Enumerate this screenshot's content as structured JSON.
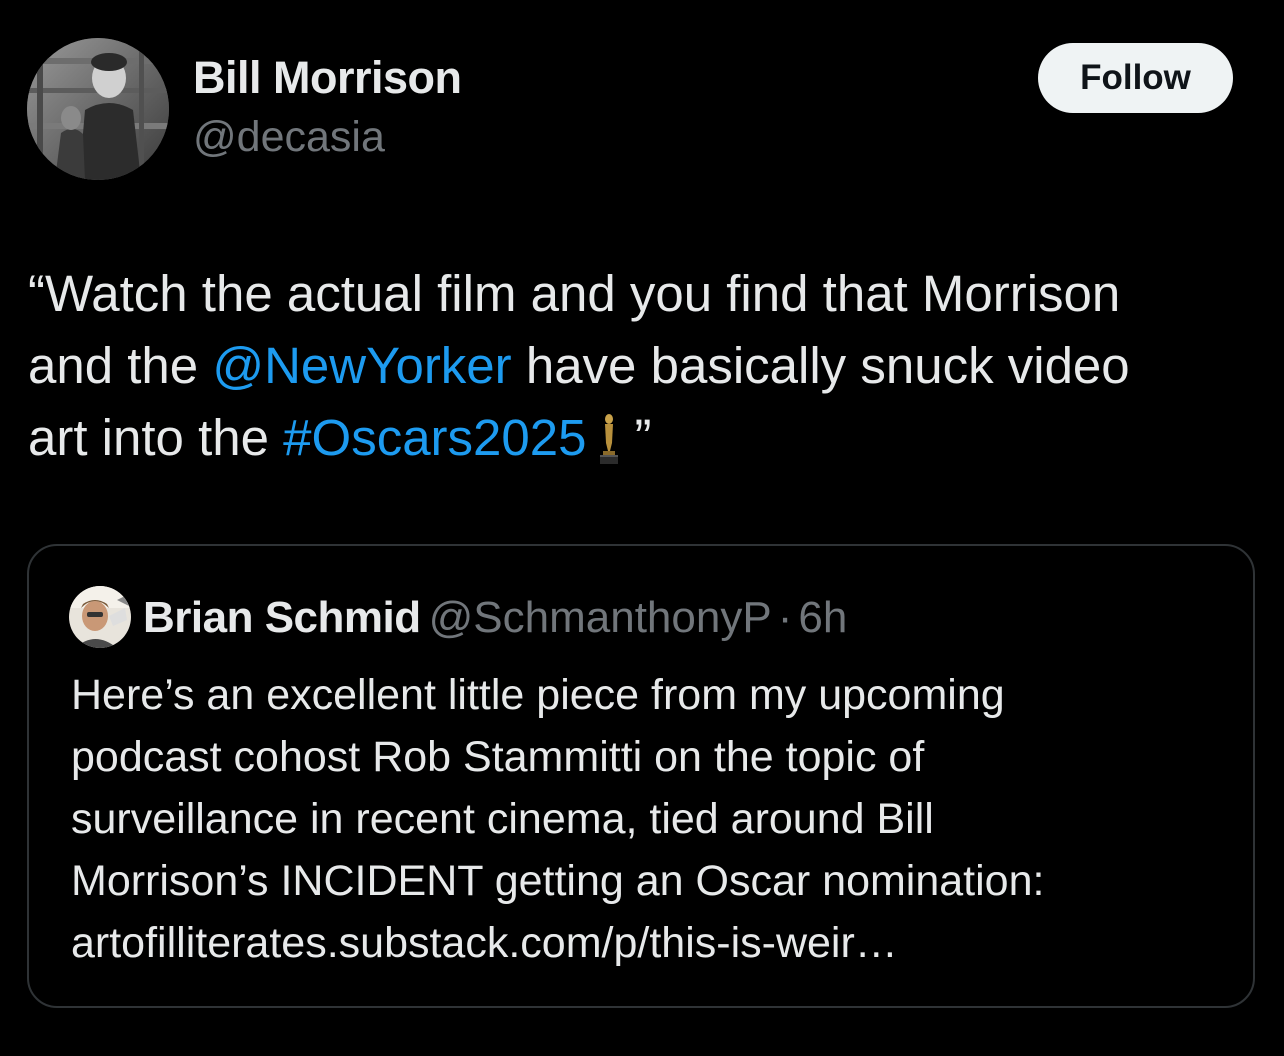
{
  "author": {
    "display_name": "Bill Morrison",
    "handle": "@decasia",
    "avatar_icon": "profile-photo-icon"
  },
  "follow_button": {
    "label": "Follow"
  },
  "tweet": {
    "line1": "“Watch the actual film and you find that Morrison",
    "line2_pre": "and the ",
    "line2_mention": "@NewYorker",
    "line2_post": " have basically snuck video",
    "line3_pre": "art into the ",
    "line3_hashtag": "#Oscars2025",
    "line3_emoji_icon": "oscar-statuette-icon",
    "line3_post": "”"
  },
  "quoted_tweet": {
    "author_name": "Brian Schmid",
    "author_handle": "@SchmanthonyP",
    "separator": "·",
    "time": "6h",
    "lines": [
      "Here’s an excellent little piece from my upcoming",
      "podcast cohost Rob Stammitti on the topic of",
      "surveillance in recent cinema, tied around Bill",
      "Morrison’s INCIDENT getting an Oscar nomination:",
      "artofilliterates.substack.com/p/this-is-weir…"
    ]
  },
  "colors": {
    "background": "#000000",
    "text": "#e7e9ea",
    "secondary": "#71767b",
    "link": "#1d9bf0",
    "border": "#2f3336",
    "button_bg": "#eff3f4"
  }
}
